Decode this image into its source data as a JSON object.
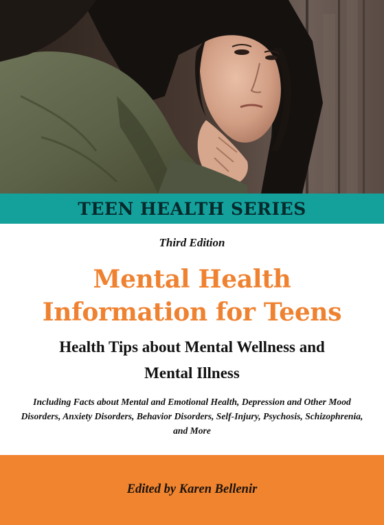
{
  "series": {
    "title": "TEEN HEALTH SERIES"
  },
  "book": {
    "edition": "Third Edition",
    "title_line1": "Mental Health",
    "title_line2": "Information for Teens",
    "subtitle_line1": "Health Tips about Mental Wellness and",
    "subtitle_line2": "Mental Illness",
    "tagline": "Including Facts about Mental and Emotional Health, Depression and Other Mood Disorders, Anxiety Disorders, Behavior Disorders, Self-Injury, Psychosis, Schizophrenia, and More",
    "editor": "Edited by Karen Bellenir"
  },
  "colors": {
    "teal_band": "#14a19c",
    "title_orange": "#ef8231",
    "editor_band": "#f0842f",
    "body_text": "#111111"
  },
  "images": {
    "cover_photo": "teen-girl-resting-chin-on-hand-photo"
  }
}
